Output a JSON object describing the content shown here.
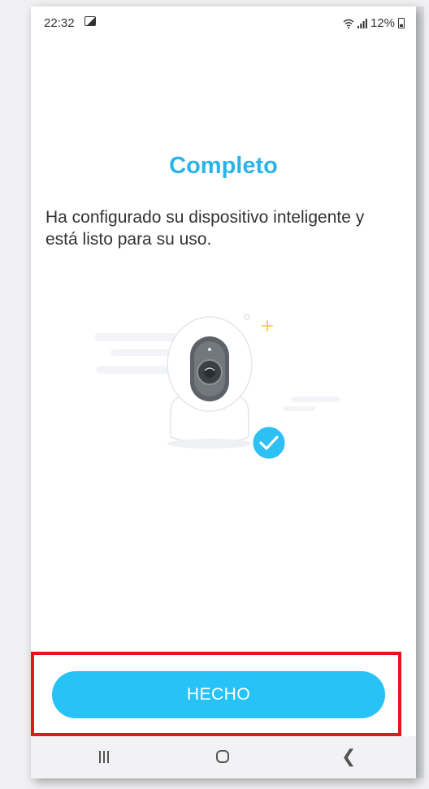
{
  "status_bar": {
    "time": "22:32",
    "battery_text": "12%",
    "icons": [
      "gallery-icon",
      "wifi-icon",
      "signal-icon",
      "battery-icon"
    ]
  },
  "main": {
    "title": "Completo",
    "message": "Ha configurado su dispositivo inteligente y está listo para su uso.",
    "illustration": "camera-success-illustration"
  },
  "actions": {
    "done_label": "HECHO"
  },
  "nav_bar": {
    "icons": [
      "recent-apps-icon",
      "home-icon",
      "back-icon"
    ]
  },
  "colors": {
    "accent": "#2bb4e8",
    "button": "#27c3f7",
    "highlight": "#e8141b",
    "check": "#2cc0f5"
  }
}
